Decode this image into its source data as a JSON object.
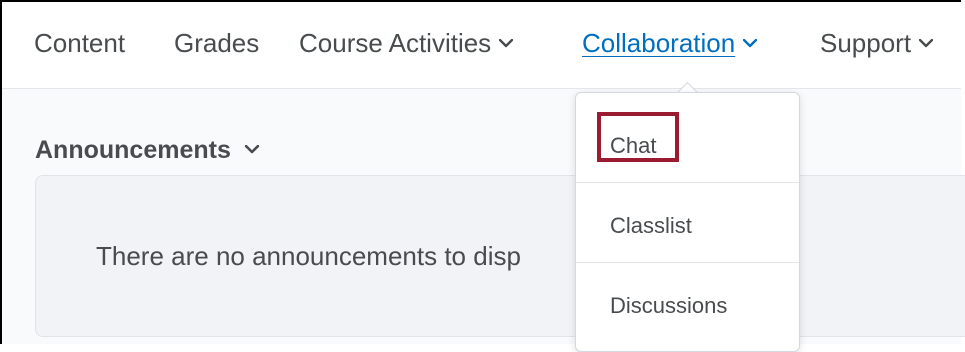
{
  "navbar": {
    "items": [
      {
        "label": "Content",
        "has_menu": false,
        "active": false
      },
      {
        "label": "Grades",
        "has_menu": false,
        "active": false
      },
      {
        "label": "Course Activities",
        "has_menu": true,
        "active": false
      },
      {
        "label": "Collaboration",
        "has_menu": true,
        "active": true
      },
      {
        "label": "Support",
        "has_menu": true,
        "active": false
      }
    ]
  },
  "announcements": {
    "title": "Announcements",
    "empty_message": "There are no announcements to disp"
  },
  "collaboration_menu": {
    "items": [
      {
        "label": "Chat",
        "highlighted": true
      },
      {
        "label": "Classlist",
        "highlighted": false
      },
      {
        "label": "Discussions",
        "highlighted": false
      }
    ]
  },
  "colors": {
    "active_link": "#006fbf",
    "text": "#494c4e",
    "highlight_box": "#9b1b30"
  }
}
